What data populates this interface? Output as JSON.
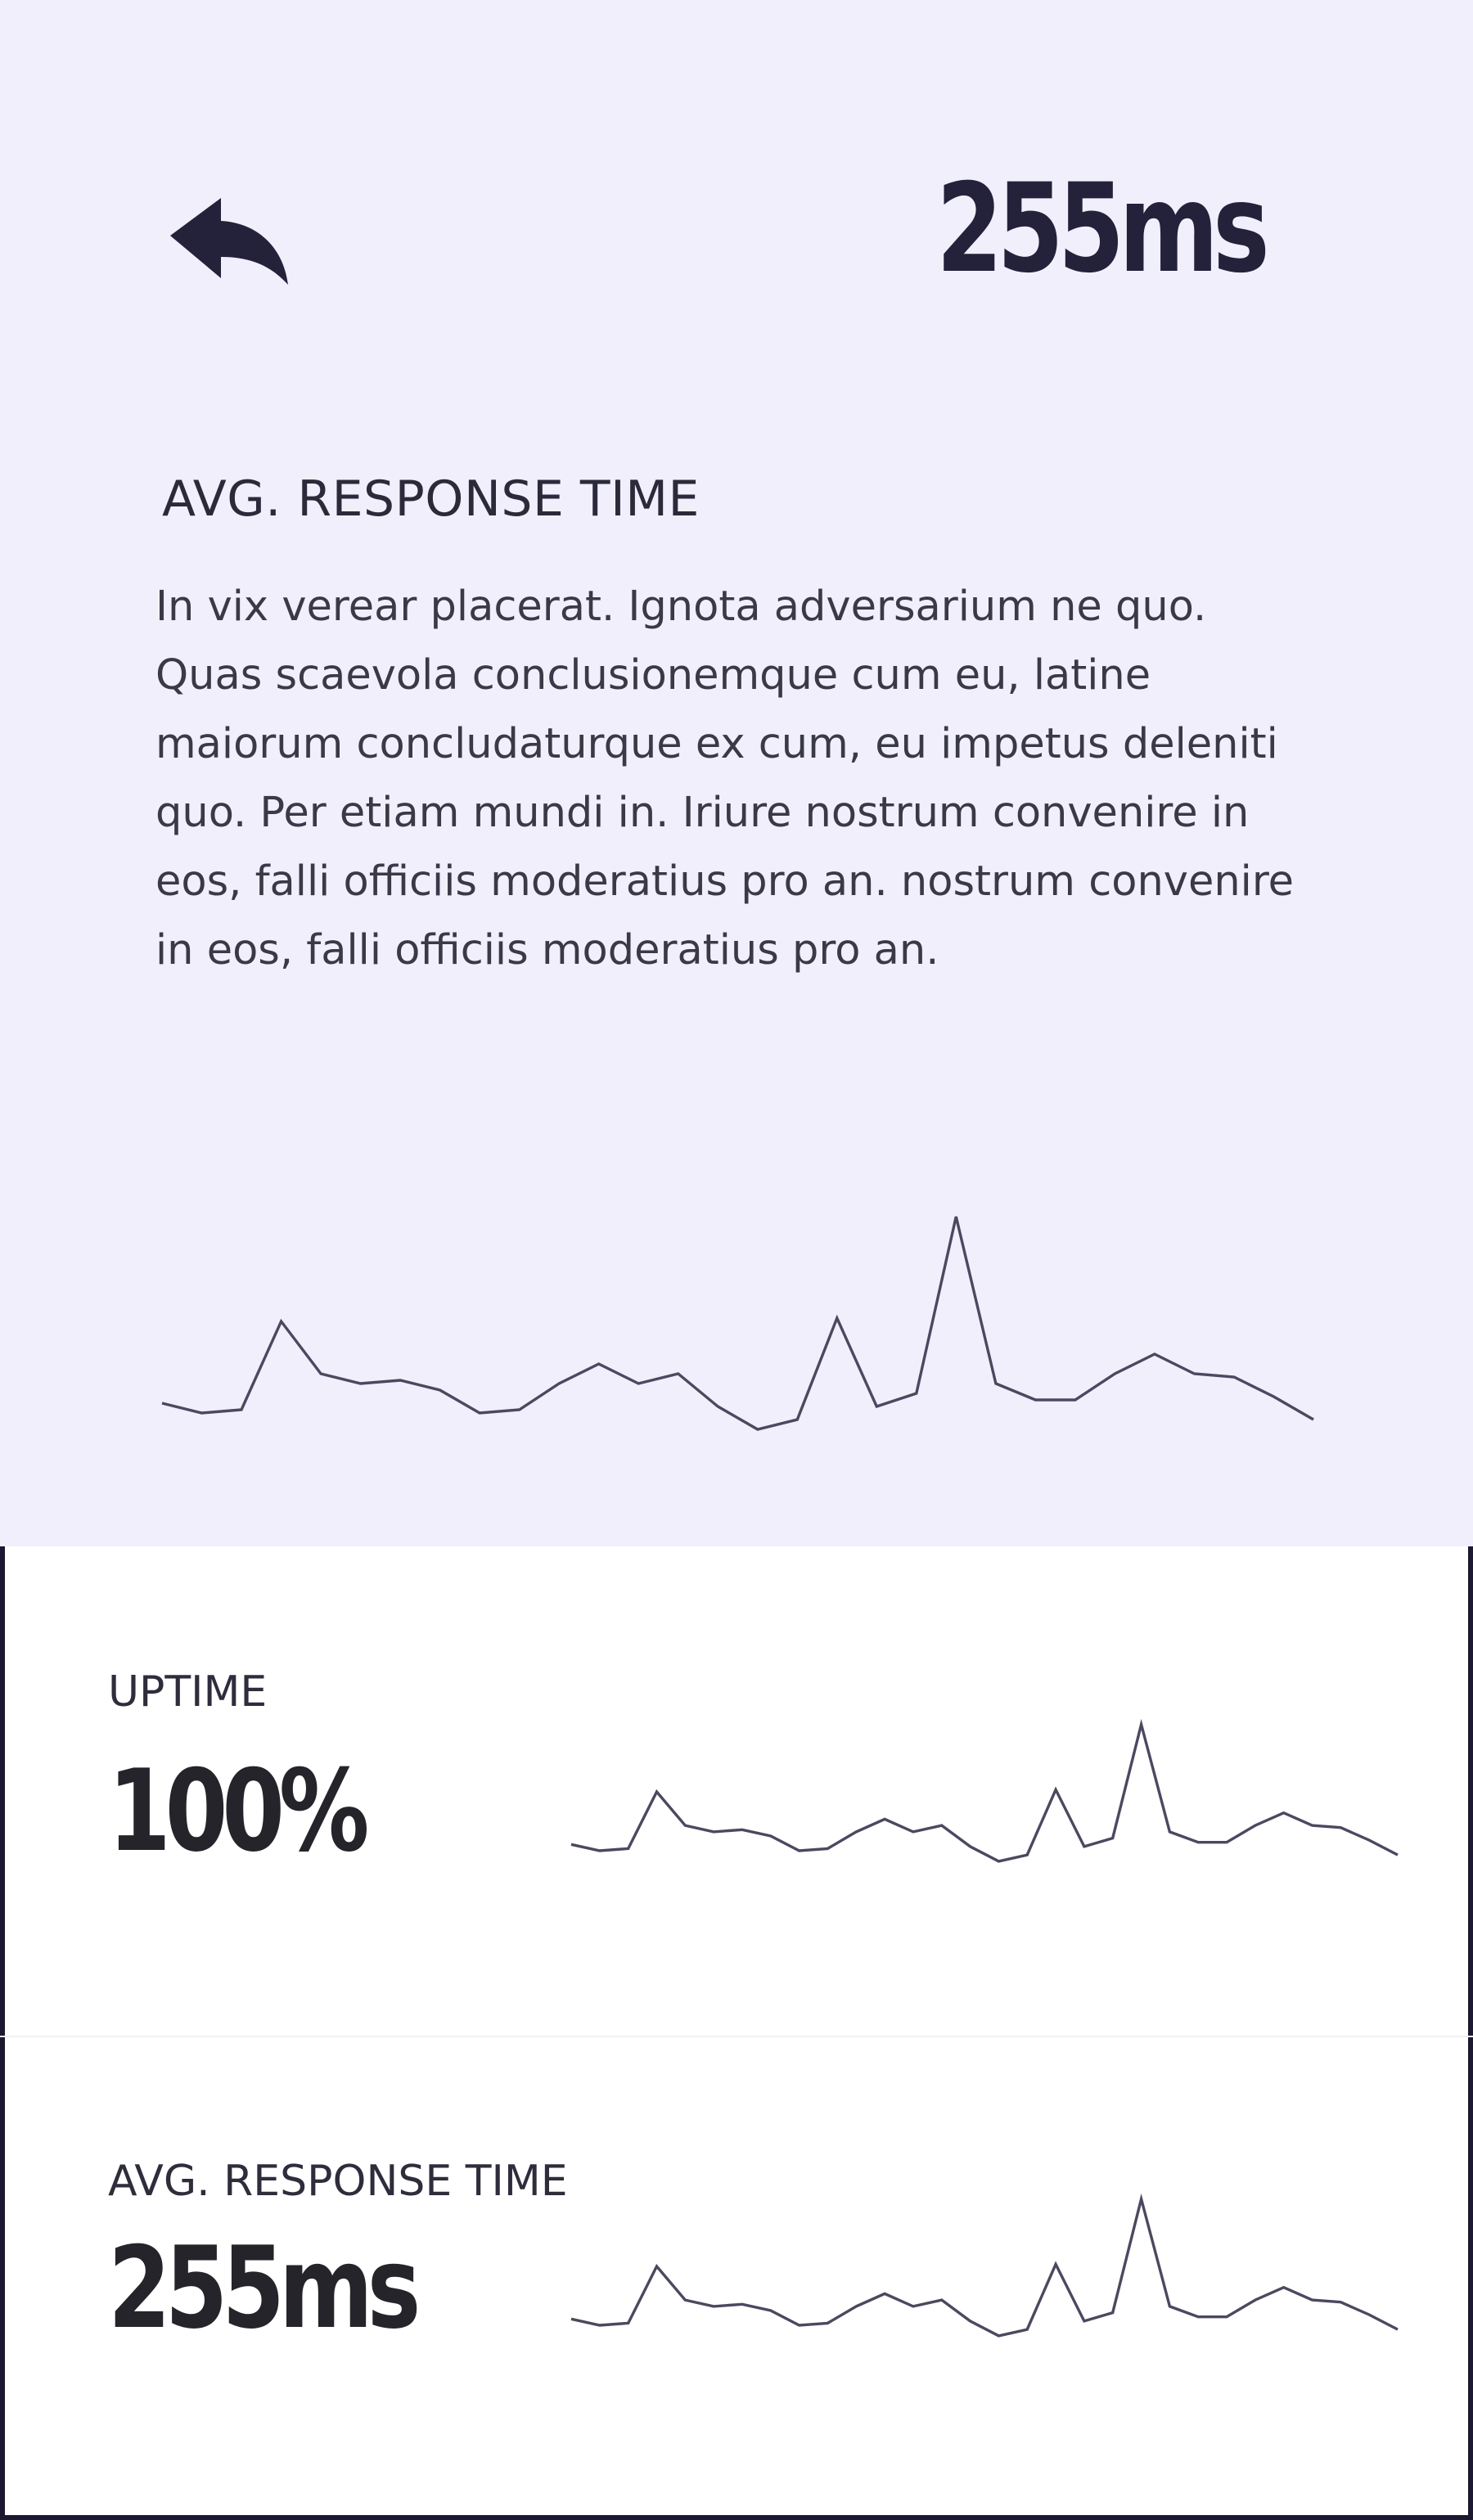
{
  "header": {
    "back_icon": "reply-arrow-icon",
    "value": "255ms"
  },
  "detail": {
    "label": "AVG. RESPONSE TIME",
    "description": "In vix verear placerat. Ignota adversarium ne quo. Quas scaevola conclusionemque cum eu, latine maiorum concludaturque ex cum, eu impetus deleniti quo. Per etiam mundi in. Iriure nostrum convenire in eos, falli officiis moderatius pro an. nostrum convenire in eos, falli officiis moderatius pro an."
  },
  "metrics": [
    {
      "label": "UPTIME",
      "value": "100%"
    },
    {
      "label": "AVG. RESPONSE TIME",
      "value": "255ms"
    }
  ],
  "colors": {
    "hero_background": "#f2effc",
    "line": "#4c4860",
    "text": "#24223a"
  },
  "chart_data": [
    {
      "type": "line",
      "x": [
        0,
        1,
        2,
        3,
        4,
        5,
        6,
        7,
        8,
        9,
        10,
        11,
        12,
        13,
        14,
        15,
        16,
        17,
        18,
        19,
        20,
        21,
        22,
        23,
        24,
        25,
        26,
        27,
        28,
        29
      ],
      "values": [
        5,
        2,
        3,
        30,
        14,
        11,
        12,
        9,
        2,
        3,
        11,
        17,
        11,
        14,
        4,
        -3,
        0,
        31,
        4,
        8,
        62,
        11,
        6,
        6,
        14,
        20,
        14,
        13,
        7,
        0
      ],
      "ylim": [
        -5,
        65
      ]
    },
    {
      "type": "line",
      "x": [
        0,
        1,
        2,
        3,
        4,
        5,
        6,
        7,
        8,
        9,
        10,
        11,
        12,
        13,
        14,
        15,
        16,
        17,
        18,
        19,
        20,
        21,
        22,
        23,
        24,
        25,
        26,
        27,
        28,
        29
      ],
      "values": [
        5,
        2,
        3,
        30,
        14,
        11,
        12,
        9,
        2,
        3,
        11,
        17,
        11,
        14,
        4,
        -3,
        0,
        31,
        4,
        8,
        62,
        11,
        6,
        6,
        14,
        20,
        14,
        13,
        7,
        0
      ],
      "ylim": [
        -5,
        65
      ]
    },
    {
      "type": "line",
      "x": [
        0,
        1,
        2,
        3,
        4,
        5,
        6,
        7,
        8,
        9,
        10,
        11,
        12,
        13,
        14,
        15,
        16,
        17,
        18,
        19,
        20,
        21,
        22,
        23,
        24,
        25,
        26,
        27,
        28,
        29
      ],
      "values": [
        5,
        2,
        3,
        30,
        14,
        11,
        12,
        9,
        2,
        3,
        11,
        17,
        11,
        14,
        4,
        -3,
        0,
        31,
        4,
        8,
        62,
        11,
        6,
        6,
        14,
        20,
        14,
        13,
        7,
        0
      ],
      "ylim": [
        -5,
        65
      ]
    }
  ]
}
